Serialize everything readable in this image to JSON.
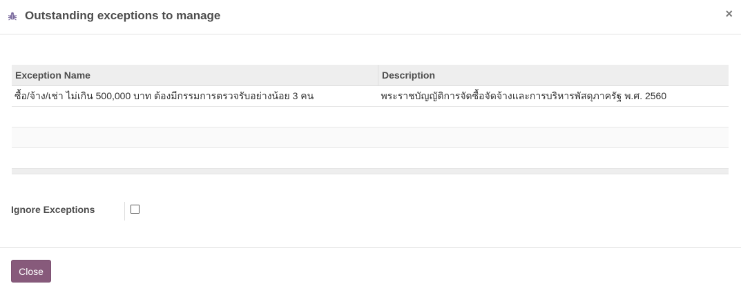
{
  "dialog": {
    "title": "Outstanding exceptions to manage",
    "title_icon": "bug-icon",
    "close_icon": "close-icon",
    "close_symbol": "×"
  },
  "table": {
    "columns": [
      "Exception Name",
      "Description"
    ],
    "rows": [
      {
        "name": "ซื้อ/จ้าง/เช่า ไม่เกิน 500,000 บาท ต้องมีกรรมการตรวจรับอย่างน้อย 3 คน",
        "description": "พระราชบัญญัติการจัดซื้อจัดจ้างและการบริหารพัสดุภาครัฐ พ.ศ. 2560"
      }
    ]
  },
  "form": {
    "ignore_label": "Ignore Exceptions",
    "ignore_checked": false
  },
  "footer": {
    "close_label": "Close"
  },
  "colors": {
    "primary": "#875a7b",
    "icon_purple": "#7c6c9f"
  }
}
